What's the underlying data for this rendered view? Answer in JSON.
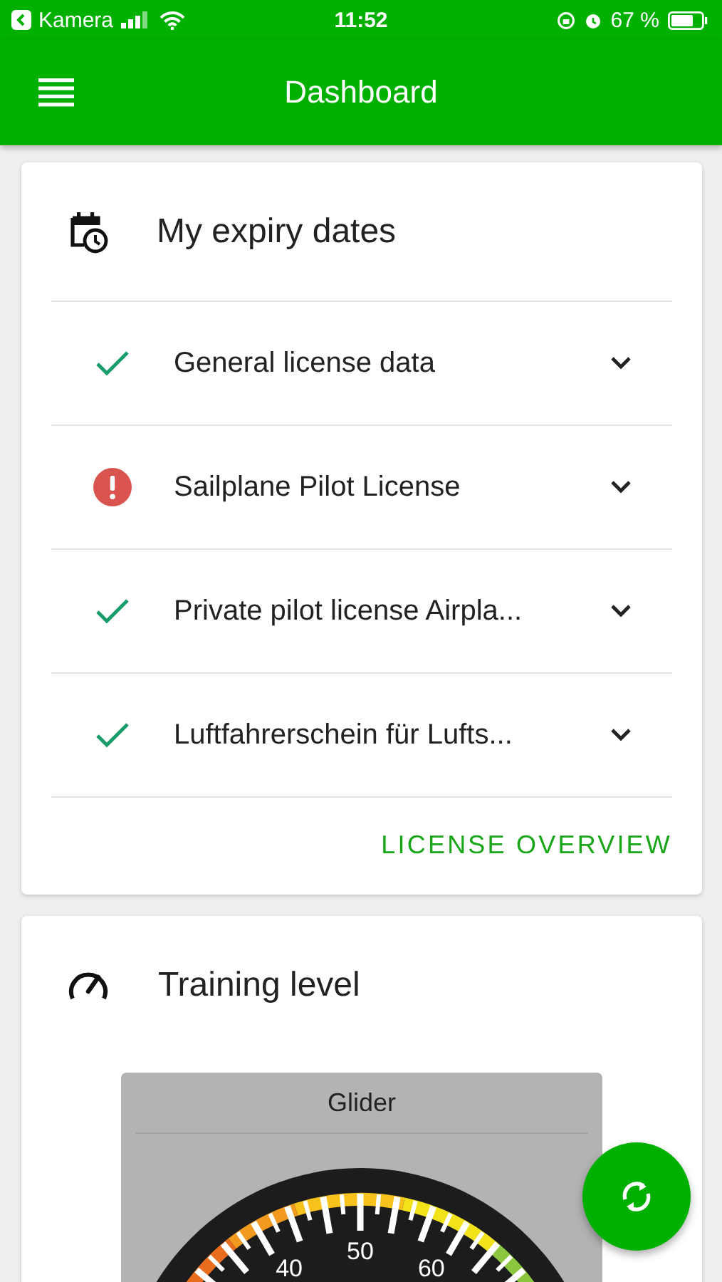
{
  "status_bar": {
    "back_label": "Kamera",
    "time": "11:52",
    "battery_text": "67 %"
  },
  "app_bar": {
    "title": "Dashboard"
  },
  "expiry_card": {
    "title": "My expiry dates",
    "items": [
      {
        "label": "General license data",
        "kind": "ok",
        "expanded": false
      },
      {
        "label": "Sailplane Pilot License",
        "kind": "error",
        "expanded": false
      },
      {
        "label": "Private pilot license Airpla...",
        "kind": "ok",
        "expanded": false
      },
      {
        "label": "Luftfahrerschein für Lufts...",
        "kind": "ok",
        "expanded": false
      }
    ],
    "link": "LICENSE OVERVIEW"
  },
  "training_card": {
    "title": "Training level",
    "gauge": {
      "title": "Glider",
      "labels": [
        "40",
        "50",
        "60"
      ]
    }
  }
}
